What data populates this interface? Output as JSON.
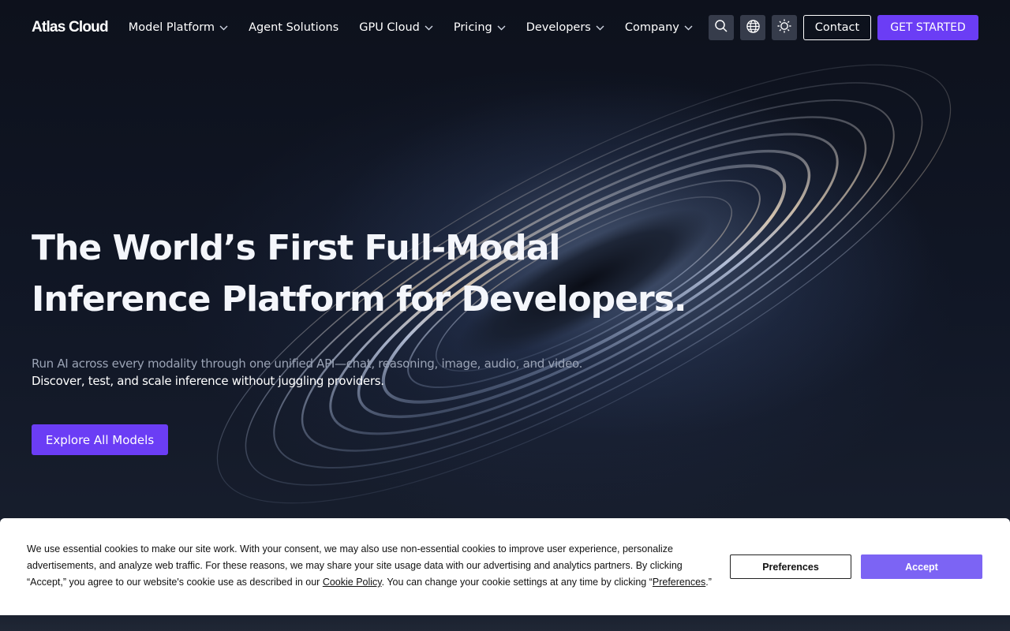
{
  "brand": {
    "logo_text": "Atlas Cloud"
  },
  "nav": {
    "items": [
      {
        "label": "Model Platform",
        "has_dropdown": true
      },
      {
        "label": "Agent Solutions",
        "has_dropdown": false
      },
      {
        "label": "GPU Cloud",
        "has_dropdown": true
      },
      {
        "label": "Pricing",
        "has_dropdown": true
      },
      {
        "label": "Developers",
        "has_dropdown": true
      },
      {
        "label": "Company",
        "has_dropdown": true
      }
    ],
    "icons": [
      "search-icon",
      "globe-icon",
      "sun-icon"
    ],
    "contact_label": "Contact",
    "get_started_label": "GET STARTED"
  },
  "hero": {
    "headline_line1": "The World’s First Full-Modal",
    "headline_line2": "Inference Platform for Developers.",
    "sub_line1": "Run AI across every modality through one unified API—chat, reasoning, image, audio, and video.",
    "sub_line2": "Discover, test, and scale inference without juggling providers.",
    "cta_label": "Explore All Models"
  },
  "cookie_banner": {
    "text_before_link": "We use essential cookies to make our site work. With your consent, we may also use non-essential cookies to improve user experience, personalize advertisements, and analyze web traffic. For these reasons, we may share your site usage data with our advertising and analytics partners. By clicking “Accept,” you agree to our website's cookie use as described in our ",
    "cookie_policy_link": "Cookie Policy",
    "text_middle": ". You can change your cookie settings at any time by clicking “",
    "preferences_link": "Preferences",
    "text_end": ".”",
    "preferences_button": "Preferences",
    "accept_button": "Accept"
  },
  "colors": {
    "accent": "#6b3df5",
    "accept": "#7c64f4",
    "background": "#0b0f1a"
  }
}
